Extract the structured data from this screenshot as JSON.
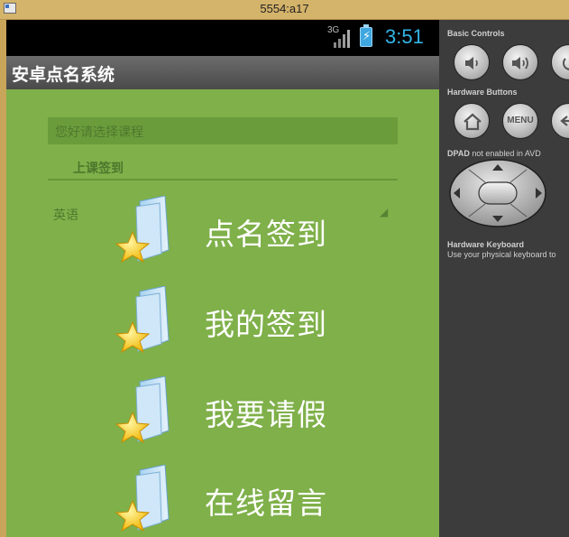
{
  "window": {
    "title": "5554:a17"
  },
  "status_bar": {
    "network": "3G",
    "time": "3:51"
  },
  "app": {
    "title": "安卓点名系统"
  },
  "background_form": {
    "field_label": "您好请选择课程",
    "sub_title": "上课签到",
    "dropdown_value": "英语"
  },
  "menu": [
    {
      "label": "点名签到"
    },
    {
      "label": "我的签到"
    },
    {
      "label": "我要请假"
    },
    {
      "label": "在线留言"
    }
  ],
  "controls": {
    "basic_controls_title": "Basic Controls",
    "hardware_buttons_title": "Hardware Buttons",
    "menu_button_label": "MENU",
    "dpad_note_prefix": "DPAD",
    "dpad_note_text": "not enabled in AVD",
    "keyboard_title": "Hardware Keyboard",
    "keyboard_note": "Use your physical keyboard to"
  },
  "colors": {
    "app_background": "#7fb04a",
    "clock": "#33b5e5",
    "panel": "#3c3c3c"
  }
}
